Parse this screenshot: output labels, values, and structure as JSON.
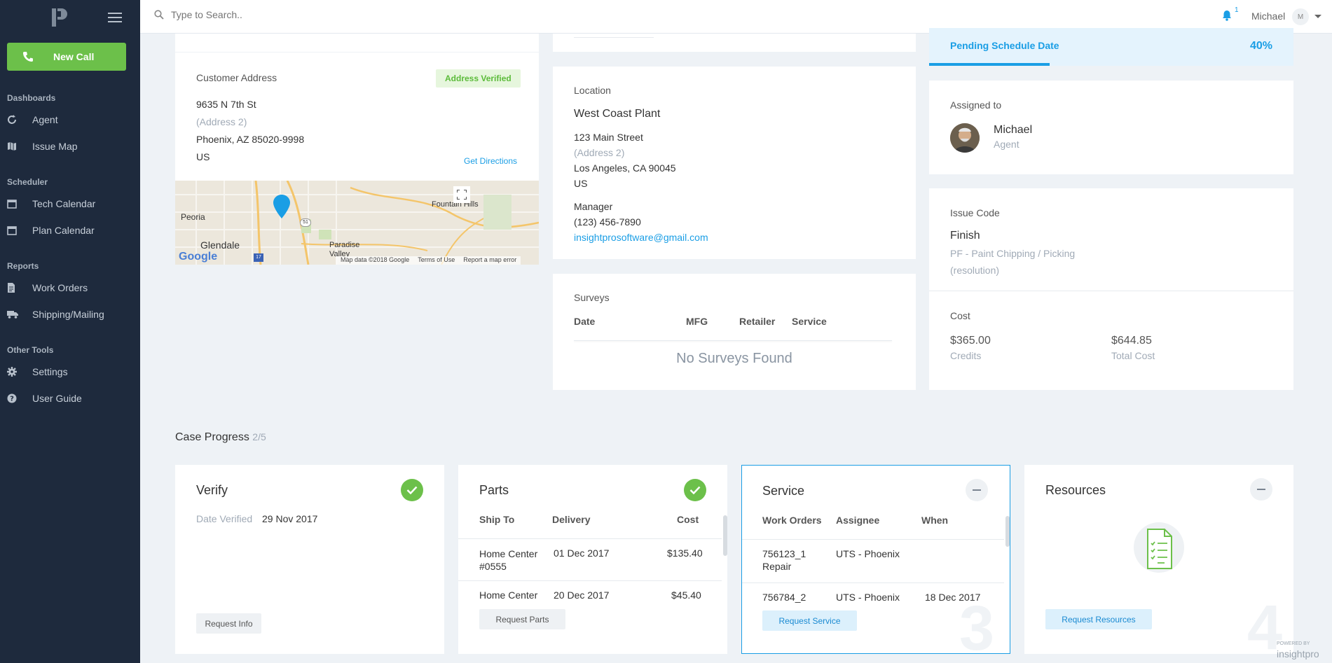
{
  "sidebar": {
    "new_call": "New Call",
    "sections": [
      {
        "title": "Dashboards",
        "items": [
          "Agent",
          "Issue Map"
        ]
      },
      {
        "title": "Scheduler",
        "items": [
          "Tech Calendar",
          "Plan Calendar"
        ]
      },
      {
        "title": "Reports",
        "items": [
          "Work Orders",
          "Shipping/Mailing"
        ]
      },
      {
        "title": "Other Tools",
        "items": [
          "Settings",
          "User Guide"
        ]
      }
    ]
  },
  "topbar": {
    "search_placeholder": "Type to Search..",
    "notification_count": "1",
    "user_name": "Michael",
    "user_initial": "M"
  },
  "customer": {
    "title": "Customer Address",
    "verified_badge": "Address Verified",
    "line1": "9635 N 7th St",
    "line2": "(Address 2)",
    "city_line": "Phoenix, AZ 85020-9998",
    "country": "US",
    "directions": "Get Directions",
    "map": {
      "labels": [
        "Peoria",
        "Glendale",
        "Fountain Hills",
        "Paradise Valley"
      ],
      "route_numbers": [
        "51",
        "17"
      ],
      "brand": "Google",
      "footer": [
        "Map data ©2018 Google",
        "Terms of Use",
        "Report a map error"
      ]
    }
  },
  "location": {
    "title": "Location",
    "name": "West Coast Plant",
    "line1": "123 Main Street",
    "line2": "(Address 2)",
    "city_line": "Los Angeles, CA 90045",
    "country": "US",
    "manager_label": "Manager",
    "phone": "(123) 456-7890",
    "email": "insightprosoftware@gmail.com"
  },
  "surveys": {
    "title": "Surveys",
    "columns": [
      "Date",
      "MFG",
      "Retailer",
      "Service"
    ],
    "empty": "No Surveys Found"
  },
  "status": {
    "label": "Pending Schedule Date",
    "percent_text": "40%",
    "progress": 0.33
  },
  "assigned": {
    "title": "Assigned to",
    "name": "Michael",
    "role": "Agent"
  },
  "issue": {
    "title": "Issue Code",
    "code": "Finish",
    "desc": "PF - Paint Chipping / Picking",
    "note": "(resolution)"
  },
  "cost": {
    "title": "Cost",
    "credits_value": "$365.00",
    "credits_label": "Credits",
    "total_value": "$644.85",
    "total_label": "Total Cost"
  },
  "case_progress": {
    "title": "Case Progress",
    "count": "2/5"
  },
  "verify": {
    "title": "Verify",
    "date_label": "Date Verified",
    "date_value": "29 Nov 2017",
    "button": "Request Info"
  },
  "parts": {
    "title": "Parts",
    "columns": [
      "Ship To",
      "Delivery",
      "Cost"
    ],
    "rows": [
      {
        "ship_to": "Home Center #0555",
        "delivery": "01 Dec 2017",
        "cost": "$135.40"
      },
      {
        "ship_to": "Home Center",
        "delivery": "20 Dec 2017",
        "cost": "$45.40"
      }
    ],
    "button": "Request Parts"
  },
  "service": {
    "title": "Service",
    "columns": [
      "Work Orders",
      "Assignee",
      "When"
    ],
    "rows": [
      {
        "order": "756123_1",
        "type": "Repair",
        "assignee": "UTS - Phoenix",
        "when": ""
      },
      {
        "order": "756784_2",
        "type": "",
        "assignee": "UTS - Phoenix",
        "when": "18 Dec 2017"
      }
    ],
    "button": "Request Service",
    "step": "3"
  },
  "resources": {
    "title": "Resources",
    "button": "Request Resources",
    "step": "4"
  },
  "footer": {
    "powered_by": "POWERED BY",
    "brand": "insightpro"
  }
}
